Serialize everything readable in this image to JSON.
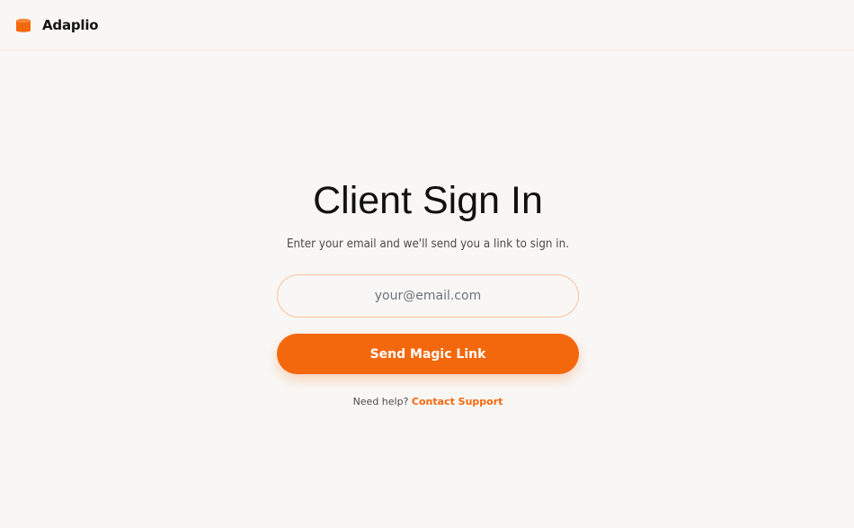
{
  "brand": {
    "name": "Adaplio",
    "logo_icon": "database-cylinder-icon",
    "accent_color": "#f4680d"
  },
  "signin": {
    "title": "Client Sign In",
    "subtitle": "Enter your email and we'll send you a link to sign in.",
    "email_placeholder": "your@email.com",
    "email_value": "",
    "submit_label": "Send Magic Link",
    "help_text": "Need help?",
    "help_link_label": "Contact Support"
  }
}
